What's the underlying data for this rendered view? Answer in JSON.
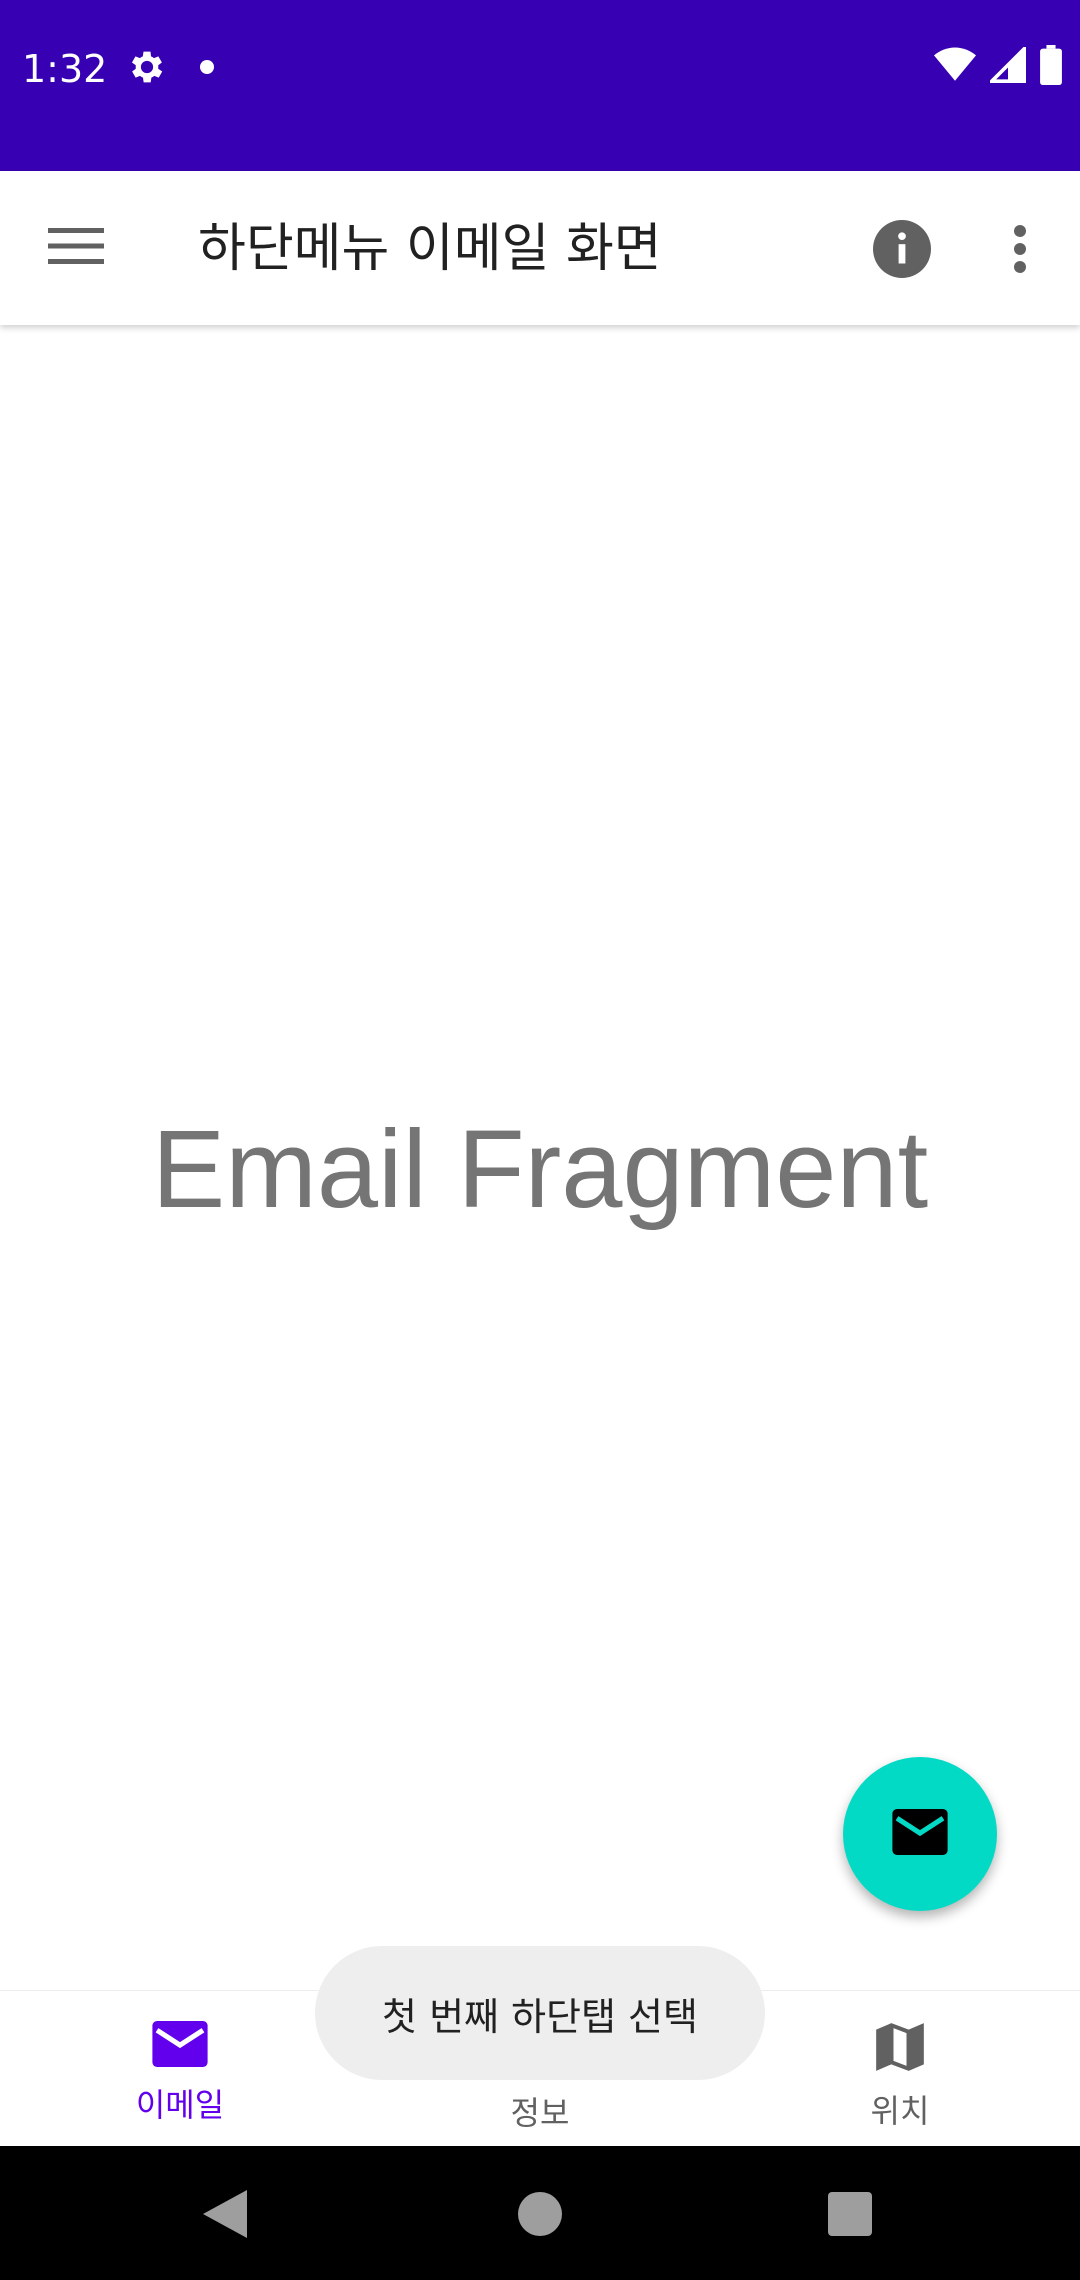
{
  "status_bar": {
    "time": "1:32",
    "background": "#3700b3",
    "icons": [
      "settings-icon",
      "notification-dot-icon",
      "wifi-icon",
      "signal-icon",
      "battery-icon"
    ]
  },
  "app_bar": {
    "title": "하단메뉴 이메일 화면",
    "actions": [
      "menu-icon",
      "info-icon",
      "more-vert-icon"
    ]
  },
  "main": {
    "fragment_text": "Email Fragment"
  },
  "fab": {
    "icon": "email-icon",
    "color": "#03dac5"
  },
  "bottom_nav": {
    "items": [
      {
        "label": "이메일",
        "icon": "email-icon",
        "active": true
      },
      {
        "label": "정보",
        "icon": "info-icon",
        "active": false
      },
      {
        "label": "위치",
        "icon": "map-icon",
        "active": false
      }
    ],
    "active_color": "#6200ee"
  },
  "toast": {
    "text": "첫 번째 하단탭 선택"
  },
  "system_nav": {
    "buttons": [
      "back-icon",
      "home-icon",
      "recents-icon"
    ]
  }
}
